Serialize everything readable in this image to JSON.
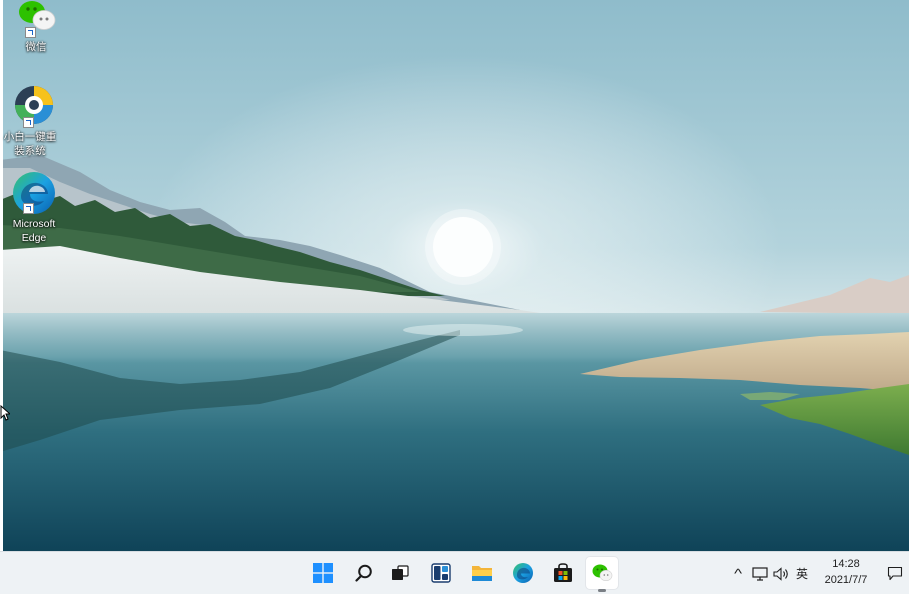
{
  "desktop": {
    "icons": [
      {
        "label": "微信",
        "icon": "wechat-icon"
      },
      {
        "label": "小白一键重装系统",
        "icon": "xiaobai-reinstall-icon"
      },
      {
        "label": "Microsoft Edge",
        "icon": "edge-icon"
      }
    ]
  },
  "taskbar": {
    "pinned": [
      {
        "name": "start",
        "icon": "windows-start-icon"
      },
      {
        "name": "search",
        "icon": "search-icon"
      },
      {
        "name": "task-view",
        "icon": "task-view-icon"
      },
      {
        "name": "widgets",
        "icon": "widgets-icon"
      },
      {
        "name": "file-explorer",
        "icon": "folder-icon"
      },
      {
        "name": "edge",
        "icon": "edge-icon"
      },
      {
        "name": "store",
        "icon": "store-icon"
      },
      {
        "name": "wechat",
        "icon": "wechat-icon",
        "active": true
      }
    ],
    "tray": {
      "chevron": "^",
      "input_method": "英",
      "time": "14:28",
      "date": "2021/7/7"
    }
  },
  "colors": {
    "taskbar_bg": "#eef2f5",
    "windows_blue": "#1e90ff",
    "wechat_green": "#2dc100"
  }
}
